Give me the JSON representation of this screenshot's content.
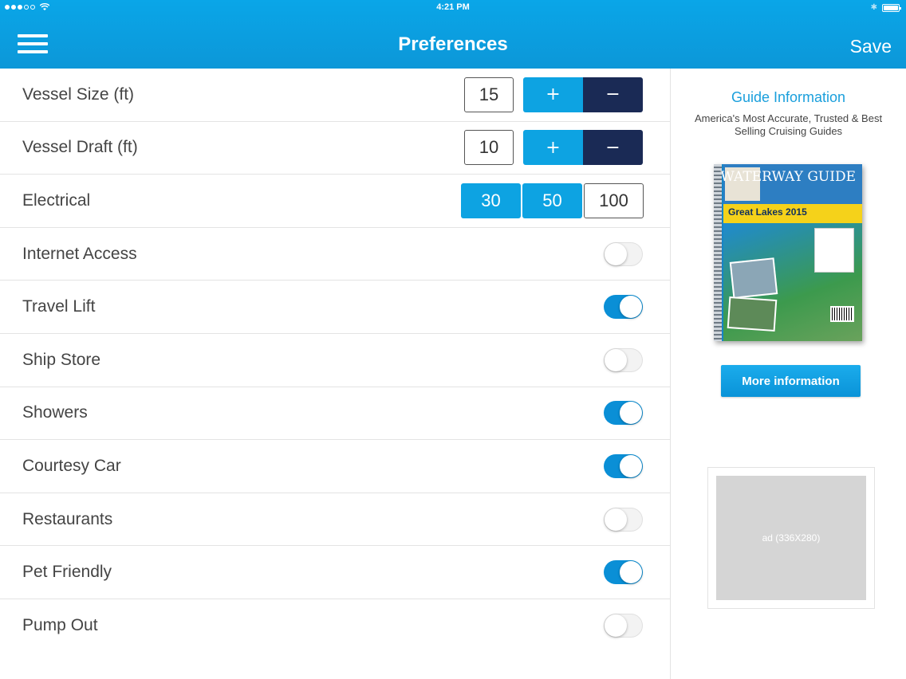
{
  "status_bar": {
    "time": "4:21 PM"
  },
  "header": {
    "title": "Preferences",
    "save_label": "Save",
    "menu_icon": "hamburger-menu-icon"
  },
  "steppers": [
    {
      "label": "Vessel Size (ft)",
      "value": "15",
      "plus": "+",
      "minus": "−"
    },
    {
      "label": "Vessel Draft (ft)",
      "value": "10",
      "plus": "+",
      "minus": "−"
    }
  ],
  "electrical": {
    "label": "Electrical",
    "options": [
      "30",
      "50",
      "100"
    ],
    "selected": [
      "30",
      "50"
    ]
  },
  "toggles": [
    {
      "label": "Internet Access",
      "on": false
    },
    {
      "label": "Travel Lift",
      "on": true
    },
    {
      "label": "Ship Store",
      "on": false
    },
    {
      "label": "Showers",
      "on": true
    },
    {
      "label": "Courtesy Car",
      "on": true
    },
    {
      "label": "Restaurants",
      "on": false
    },
    {
      "label": "Pet Friendly",
      "on": true
    },
    {
      "label": "Pump Out",
      "on": false
    }
  ],
  "side": {
    "title": "Guide Information",
    "subtitle": "America's Most Accurate, Trusted & Best Selling Cruising Guides",
    "book": {
      "brand": "WATERWAY GUIDE",
      "band_text": "Great Lakes 2015"
    },
    "more_label": "More information",
    "ad_label": "ad (336X280)"
  },
  "colors": {
    "accent": "#0da3e2",
    "dark": "#1a2a55",
    "toggle_on": "#0a8fd6"
  }
}
